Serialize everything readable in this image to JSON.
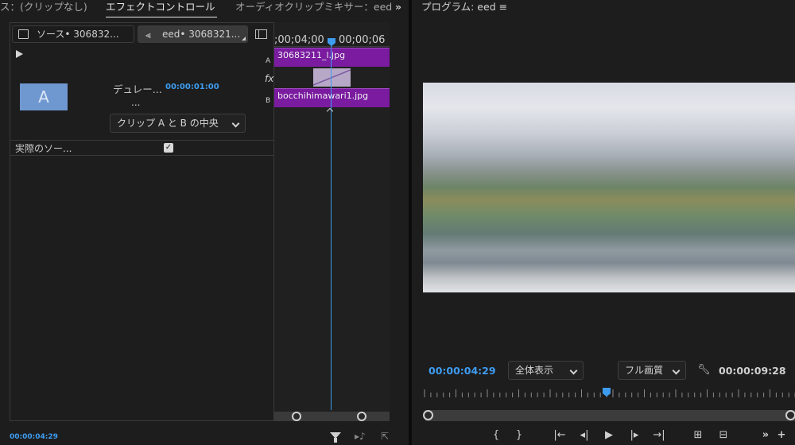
{
  "tabs": {
    "source": "ス：(クリップなし)",
    "effect_controls": "エフェクトコントロール ≡",
    "audio_mixer": "オーディオクリップミキサー：eed",
    "overflow": "»",
    "program": "プログラム: eed ≡"
  },
  "effect_controls": {
    "source_chip": "ソース• 306832...",
    "sequence_chip": "eed• 3068321...",
    "ruler_time_1": ";00;04;00",
    "ruler_time_2": "00;00;06",
    "track_a": "A",
    "track_b": "B",
    "fx_label": "fx",
    "clip_a_name": "30683211_l.jpg",
    "clip_b_name": "bocchihimawari1.jpg",
    "preview_letter": "A",
    "duration_label": "デュレー...",
    "duration_value": "00:00:01:00",
    "ellipsis": "...",
    "alignment_select": "クリップ A と B の中央",
    "actual_source_label": "実際のソー...",
    "actual_source_checked": true,
    "footer_timecode": "00:00:04:29"
  },
  "program": {
    "current_time": "00:00:04:29",
    "zoom_select": "全体表示",
    "quality_select": "フル画質",
    "duration": "00:00:09:28",
    "playhead_fraction": 0.5
  },
  "colors": {
    "accent_blue": "#3e9cf0",
    "clip_purple": "#7a1ba0",
    "preview_blue": "#6f97d0"
  }
}
